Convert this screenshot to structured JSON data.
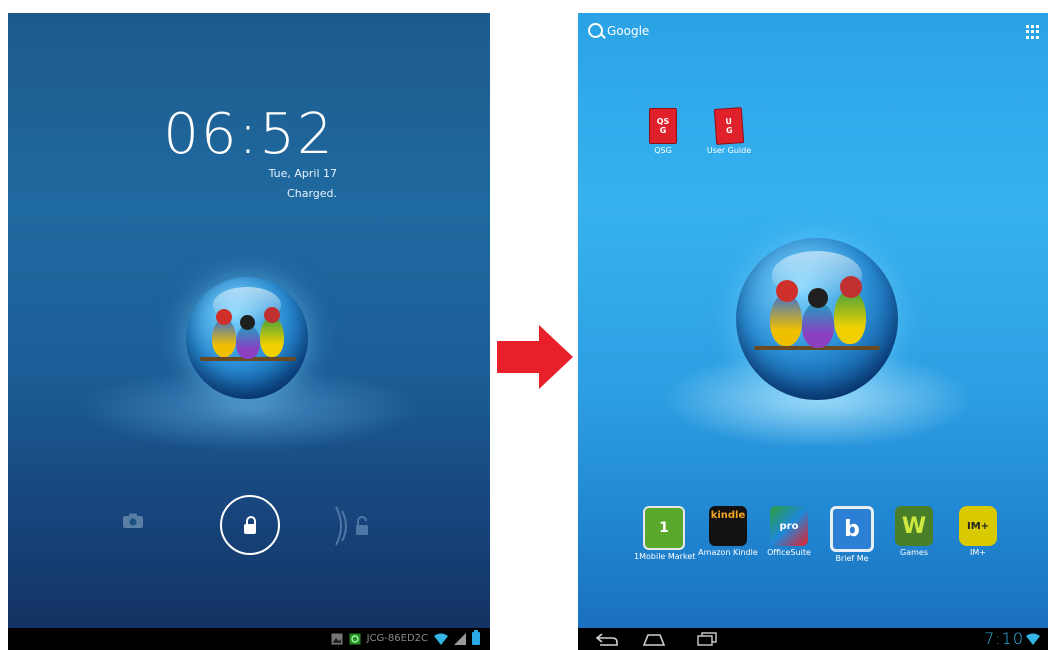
{
  "lock_screen": {
    "time": "06:52",
    "date": "Tue, April 17",
    "status": "Charged.",
    "status_bar": {
      "network_name": "JCG-86ED2C"
    },
    "icons": [
      "camera-icon",
      "padlock-icon",
      "unlock-icon",
      "wifi-icon",
      "signal-icon",
      "battery-icon"
    ]
  },
  "home_screen": {
    "search_label": "Google",
    "desktop_icons": [
      {
        "label": "QSG"
      },
      {
        "label": "User Guide"
      }
    ],
    "dock": [
      {
        "label": "1Mobile Market",
        "glyph": "1",
        "color": "#5aa82c"
      },
      {
        "label": "Amazon Kindle",
        "glyph": "kindle",
        "color": "#111111"
      },
      {
        "label": "OfficeSuite",
        "glyph": "pro",
        "color": "#1e88d8"
      },
      {
        "label": "Brief Me",
        "glyph": "b",
        "color": "#2b7fd4"
      },
      {
        "label": "Games",
        "glyph": "W",
        "color": "#5a9c2a"
      },
      {
        "label": "IM+",
        "glyph": "IM+",
        "color": "#c9c300"
      }
    ],
    "status_bar": {
      "time": "7:10"
    },
    "nav_buttons": [
      "back-icon",
      "home-icon",
      "recents-icon"
    ]
  },
  "colors": {
    "accent": "#33b5e5",
    "arrow": "#e8202a"
  }
}
